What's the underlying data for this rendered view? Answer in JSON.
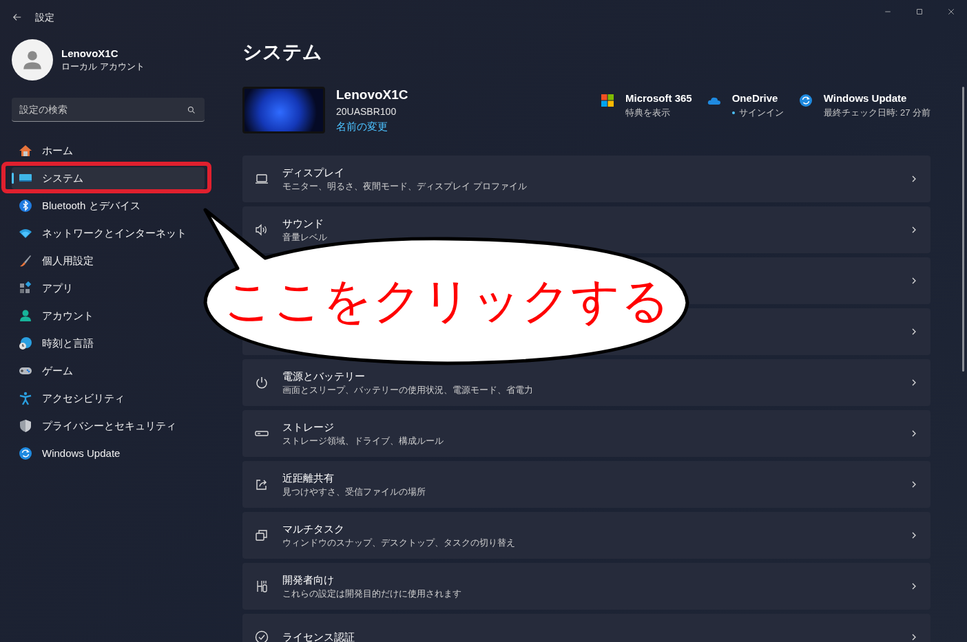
{
  "window": {
    "title": "設定"
  },
  "account": {
    "name": "LenovoX1C",
    "type": "ローカル アカウント"
  },
  "search": {
    "placeholder": "設定の検索"
  },
  "sidebar": {
    "items": [
      {
        "label": "ホーム",
        "selected": false
      },
      {
        "label": "システム",
        "selected": true
      },
      {
        "label": "Bluetooth とデバイス",
        "selected": false
      },
      {
        "label": "ネットワークとインターネット",
        "selected": false
      },
      {
        "label": "個人用設定",
        "selected": false
      },
      {
        "label": "アプリ",
        "selected": false
      },
      {
        "label": "アカウント",
        "selected": false
      },
      {
        "label": "時刻と言語",
        "selected": false
      },
      {
        "label": "ゲーム",
        "selected": false
      },
      {
        "label": "アクセシビリティ",
        "selected": false
      },
      {
        "label": "プライバシーとセキュリティ",
        "selected": false
      },
      {
        "label": "Windows Update",
        "selected": false
      }
    ]
  },
  "page_title": "システム",
  "device": {
    "name": "LenovoX1C",
    "model": "20UASBR100",
    "rename_link": "名前の変更"
  },
  "services": [
    {
      "title": "Microsoft 365",
      "subtitle": "特典を表示",
      "dot": false
    },
    {
      "title": "OneDrive",
      "subtitle": "サインイン",
      "dot": true
    },
    {
      "title": "Windows Update",
      "subtitle": "最終チェック日時: 27 分前",
      "dot": false
    }
  ],
  "settings": [
    {
      "kind": "item",
      "title": "ディスプレイ",
      "description": "モニター、明るさ、夜間モード、ディスプレイ プロファイル"
    },
    {
      "kind": "item",
      "title": "サウンド",
      "description": "音量レベル"
    },
    {
      "kind": "hidden"
    },
    {
      "kind": "hidden"
    },
    {
      "kind": "item",
      "title": "電源とバッテリー",
      "description": "画面とスリープ、バッテリーの使用状況、電源モード、省電力"
    },
    {
      "kind": "item",
      "title": "ストレージ",
      "description": "ストレージ領域、ドライブ、構成ルール"
    },
    {
      "kind": "item",
      "title": "近距離共有",
      "description": "見つけやすさ、受信ファイルの場所"
    },
    {
      "kind": "item",
      "title": "マルチタスク",
      "description": "ウィンドウのスナップ、デスクトップ、タスクの切り替え"
    },
    {
      "kind": "item",
      "title": "開発者向け",
      "description": "これらの設定は開発目的だけに使用されます"
    },
    {
      "kind": "item",
      "title": "ライセンス認証"
    }
  ],
  "annotation": {
    "callout_text": "ここをクリックする"
  }
}
